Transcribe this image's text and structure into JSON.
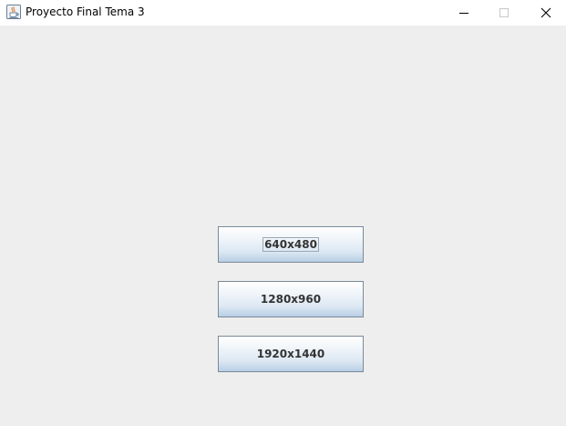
{
  "window": {
    "title": "Proyecto Final Tema 3",
    "icon": "java-cup-icon"
  },
  "titlebar_controls": {
    "minimize_icon": "minimize-icon",
    "maximize_icon": "maximize-icon",
    "close_icon": "close-icon"
  },
  "buttons": [
    {
      "label": "640x480",
      "focused": true
    },
    {
      "label": "1280x960",
      "focused": false
    },
    {
      "label": "1920x1440",
      "focused": false
    }
  ]
}
